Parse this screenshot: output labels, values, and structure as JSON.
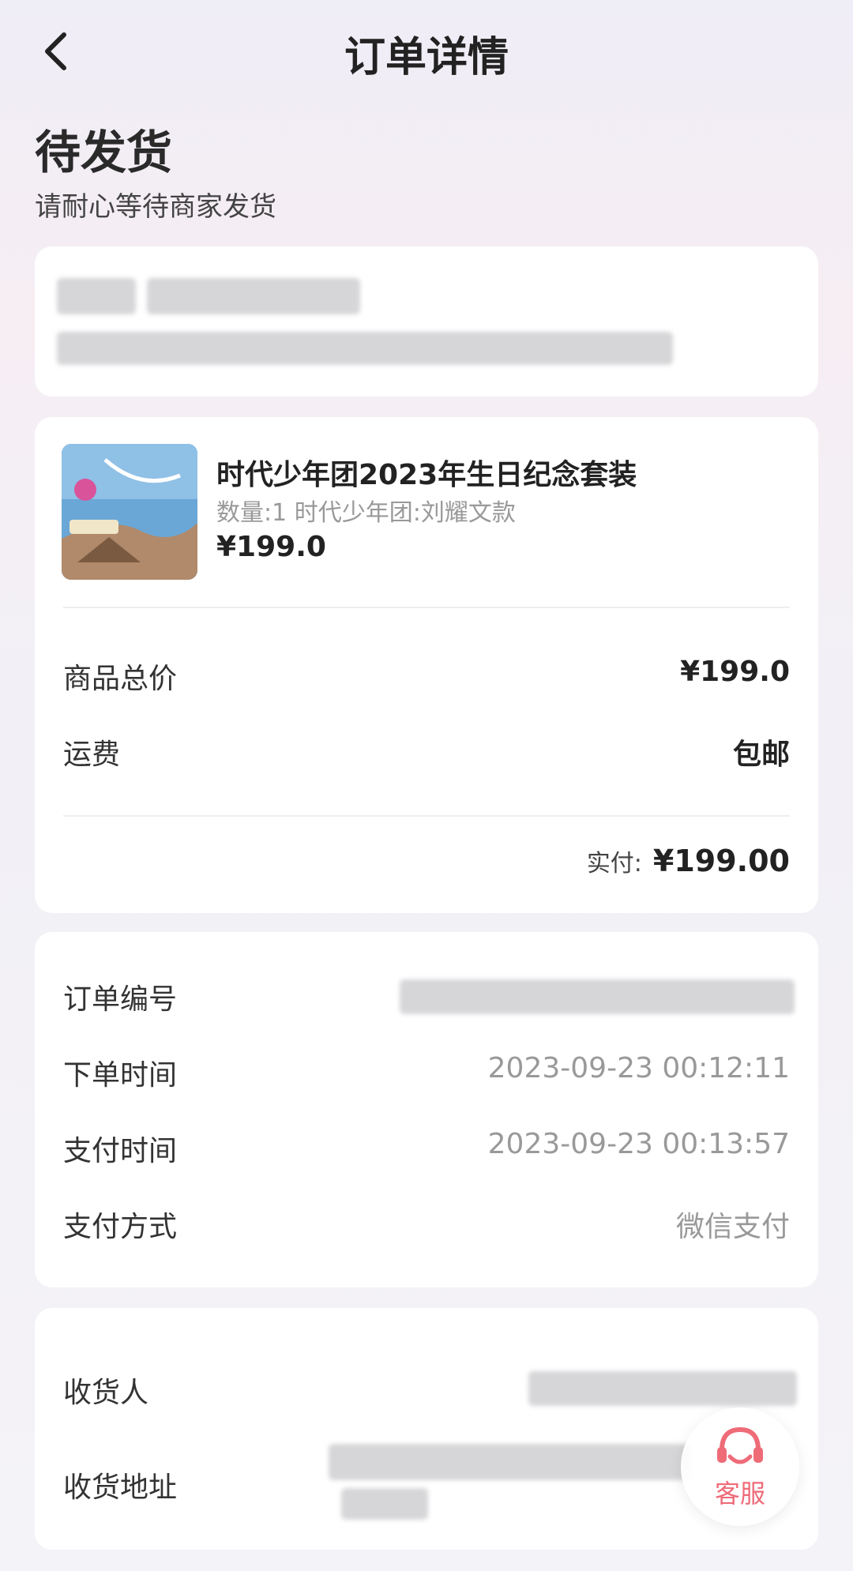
{
  "header": {
    "title": "订单详情"
  },
  "status": {
    "title": "待发货",
    "subtitle": "请耐心等待商家发货"
  },
  "product": {
    "title": "时代少年团2023年生日纪念套装",
    "spec": "数量:1 时代少年团:刘耀文款",
    "price": "¥199.0"
  },
  "summary": {
    "goods_total_label": "商品总价",
    "goods_total_value": "¥199.0",
    "shipping_label": "运费",
    "shipping_value": "包邮",
    "paid_label": "实付:",
    "paid_value": "¥199.00"
  },
  "order_info": {
    "order_no_label": "订单编号",
    "order_time_label": "下单时间",
    "order_time_value": "2023-09-23 00:12:11",
    "pay_time_label": "支付时间",
    "pay_time_value": "2023-09-23 00:13:57",
    "pay_method_label": "支付方式",
    "pay_method_value": "微信支付"
  },
  "receiver": {
    "name_label": "收货人",
    "address_label": "收货地址"
  },
  "service_button": {
    "label": "客服",
    "icon": "headset-icon"
  },
  "colors": {
    "service_accent": "#ee6b78"
  }
}
